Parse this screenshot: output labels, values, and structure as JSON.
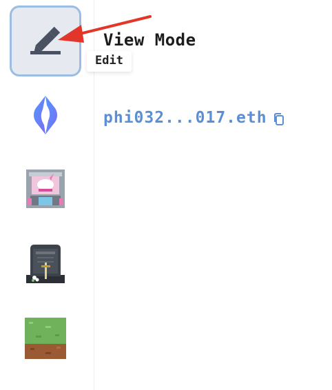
{
  "header": {
    "title": "View Mode"
  },
  "tooltip": {
    "text": "Edit"
  },
  "profile": {
    "address": "phi032...017.eth"
  },
  "sidebar": {
    "items": [
      {
        "icon": "pencil-icon"
      },
      {
        "icon": "ens-logo-icon"
      },
      {
        "icon": "unicorn-shop-icon"
      },
      {
        "icon": "loot-tombstone-icon"
      },
      {
        "icon": "grass-block-icon"
      }
    ]
  },
  "colors": {
    "accent_blue": "#5b8fd3",
    "edit_button_bg": "#e6e9ef",
    "edit_button_border": "#9bbce3",
    "annotation_red": "#e2362b"
  }
}
